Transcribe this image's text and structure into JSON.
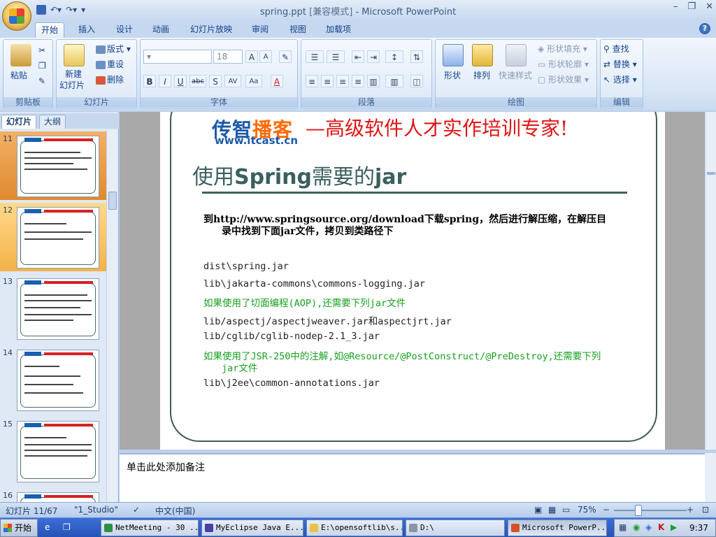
{
  "window": {
    "title": "spring.ppt",
    "mode": "[兼容模式]",
    "app": "Microsoft PowerPoint",
    "minimize": "–",
    "restore": "❐",
    "close": "✕"
  },
  "ribbon_tabs": [
    "开始",
    "插入",
    "设计",
    "动画",
    "幻灯片放映",
    "审阅",
    "视图",
    "加载项"
  ],
  "help": "?",
  "groups": {
    "clipboard": {
      "label": "剪贴板",
      "paste": "粘贴"
    },
    "slides": {
      "label": "幻灯片",
      "new_slide_1": "新建",
      "new_slide_2": "幻灯片",
      "layout": "版式",
      "reset": "重设",
      "delete": "删除"
    },
    "font": {
      "label": "字体",
      "font_size": "18",
      "bold": "B",
      "italic": "I",
      "underline": "U",
      "strike": "abc",
      "shadow": "S",
      "spacing": "AV",
      "case": "Aa",
      "color": "A",
      "grow": "A",
      "shrink": "A"
    },
    "paragraph": {
      "label": "段落"
    },
    "drawing": {
      "label": "绘图",
      "shape": "形状",
      "arrange": "排列",
      "quick_styles": "快速样式",
      "fill": "形状填充",
      "outline": "形状轮廓",
      "effects": "形状效果"
    },
    "editing": {
      "label": "编辑",
      "find": "查找",
      "replace": "替换",
      "select": "选择"
    }
  },
  "pane": {
    "tab_slides": "幻灯片",
    "tab_outline": "大纲",
    "close": "✕",
    "thumb_numbers": [
      "11",
      "12",
      "13",
      "14",
      "15",
      "16"
    ],
    "selected": "12"
  },
  "slide": {
    "brand_a": "传智",
    "brand_b": "播客",
    "brand_url": "www.itcast.cn",
    "slogan": "—高级软件人才实作培训专家!",
    "title_a": "使用",
    "title_b": "Spring",
    "title_c": "需要的",
    "title_d": "jar",
    "intro_1": "到http://www.springsource.org/download下载spring，然后进行解压缩，在解压目",
    "intro_2": "录中找到下面jar文件，拷贝到类路径下",
    "lines": [
      {
        "text": "dist\\spring.jar",
        "green": false
      },
      {
        "text": "lib\\jakarta-commons\\commons-logging.jar",
        "green": false
      },
      {
        "text": "如果使用了切面编程(AOP),还需要下列jar文件",
        "green": true
      },
      {
        "text": "lib/aspectj/aspectjweaver.jar和aspectjrt.jar",
        "green": false
      },
      {
        "text": "lib/cglib/cglib-nodep-2.1_3.jar",
        "green": false
      },
      {
        "text": "如果使用了JSR-250中的注解,如@Resource/@PostConstruct/@PreDestroy,还需要下列",
        "green": true
      },
      {
        "text": "jar文件",
        "green": true,
        "indent": true
      },
      {
        "text": "lib\\j2ee\\common-annotations.jar",
        "green": false
      }
    ]
  },
  "notes": {
    "placeholder": "单击此处添加备注"
  },
  "status": {
    "slide_of": "幻灯片 11/67",
    "theme": "\"1_Studio\"",
    "language": "中文(中国)",
    "zoom": "75%",
    "zoom_minus": "−",
    "zoom_plus": "+"
  },
  "taskbar": {
    "start": "开始",
    "tasks": [
      "NetMeeting - 30 ...",
      "MyEclipse Java E...",
      "E:\\opensoftlib\\s...",
      "D:\\",
      "Microsoft PowerP..."
    ],
    "active_index": 4,
    "clock": "9:37"
  },
  "colors": {
    "accent": "#15428b",
    "slogan": "#e01414",
    "brand": "#1e5aa8",
    "green_text": "#19a020"
  }
}
